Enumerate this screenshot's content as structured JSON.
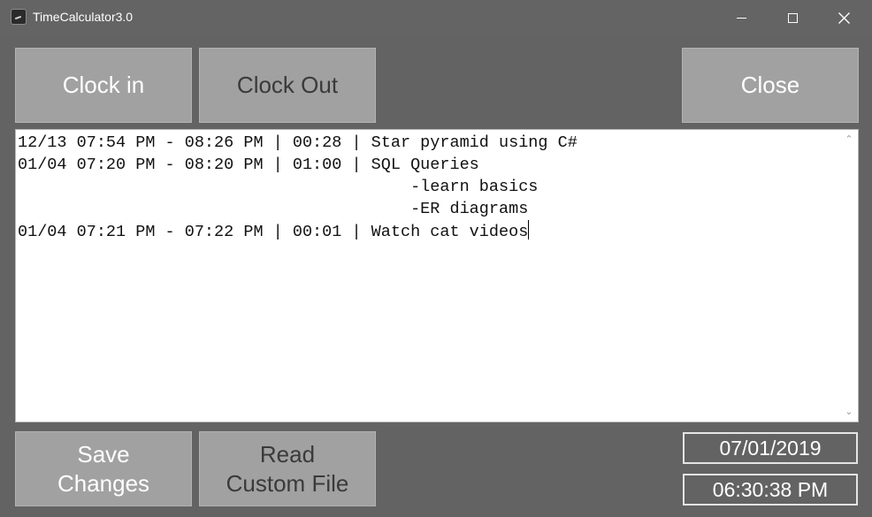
{
  "window": {
    "title": "TimeCalculator3.0"
  },
  "toolbar": {
    "clock_in_label": "Clock in",
    "clock_out_label": "Clock Out",
    "close_label": "Close"
  },
  "log": {
    "lines": [
      "12/13 07:54 PM - 08:26 PM | 00:28 | Star pyramid using C#",
      "01/04 07:20 PM - 08:20 PM | 01:00 | SQL Queries",
      "                                        -learn basics",
      "                                        -ER diagrams",
      "01/04 07:21 PM - 07:22 PM | 00:01 | Watch cat videos"
    ]
  },
  "actions": {
    "save_line1": "Save",
    "save_line2": "Changes",
    "read_line1": "Read",
    "read_line2": "Custom File"
  },
  "status": {
    "date": "07/01/2019",
    "time": "06:30:38 PM"
  },
  "colors": {
    "background": "#636363",
    "button": "#a1a1a1",
    "log_background": "#ffffff"
  }
}
